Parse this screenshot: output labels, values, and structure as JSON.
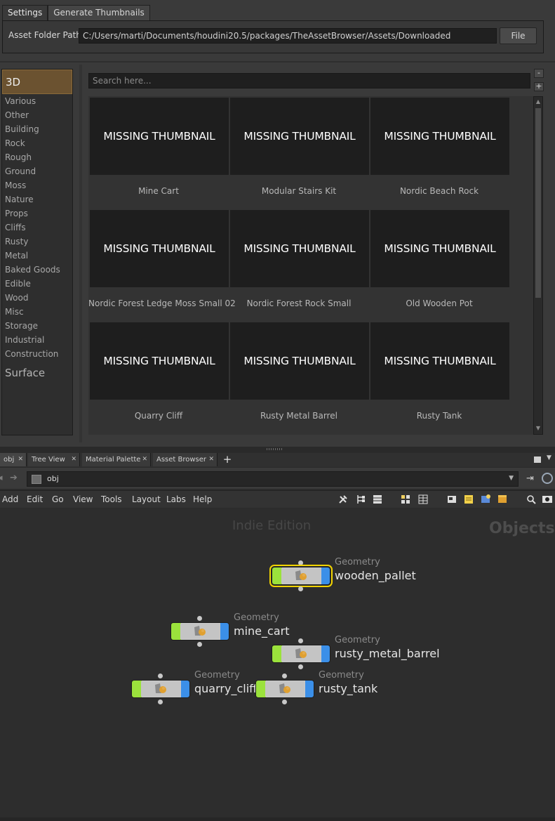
{
  "browser": {
    "tabs": [
      "Settings",
      "Generate Thumbnails"
    ],
    "asset_folder_label": "Asset Folder Path",
    "asset_folder_value": "C:/Users/marti/Documents/houdini20.5/packages/TheAssetBrowser/Assets/Downloaded",
    "file_button": "File",
    "search_placeholder": "Search here...",
    "minus_button": "-",
    "plus_button": "+",
    "categories": {
      "active_group": "3D",
      "items": [
        "Various",
        "Other",
        "Building",
        "Rock",
        "Rough",
        "Ground",
        "Moss",
        "Nature",
        "Props",
        "Cliffs",
        "Rusty",
        "Metal",
        "Baked Goods",
        "Edible",
        "Wood",
        "Misc",
        "Storage",
        "Industrial",
        "Construction"
      ],
      "other_group": "Surface"
    },
    "assets": [
      {
        "thumb": "MISSING THUMBNAIL",
        "name": "Mine Cart"
      },
      {
        "thumb": "MISSING THUMBNAIL",
        "name": "Modular Stairs Kit"
      },
      {
        "thumb": "MISSING THUMBNAIL",
        "name": "Nordic Beach Rock"
      },
      {
        "thumb": "MISSING THUMBNAIL",
        "name": "Nordic Forest Ledge Moss Small 02"
      },
      {
        "thumb": "MISSING THUMBNAIL",
        "name": "Nordic Forest Rock Small"
      },
      {
        "thumb": "MISSING THUMBNAIL",
        "name": "Old Wooden Pot"
      },
      {
        "thumb": "MISSING THUMBNAIL",
        "name": "Quarry Cliff"
      },
      {
        "thumb": "MISSING THUMBNAIL",
        "name": "Rusty Metal Barrel"
      },
      {
        "thumb": "MISSING THUMBNAIL",
        "name": "Rusty Tank"
      }
    ]
  },
  "network": {
    "tabs": [
      "obj",
      "Tree View",
      "Material Palette",
      "Asset Browser"
    ],
    "path": "obj",
    "menus": [
      "Add",
      "Edit",
      "Go",
      "View",
      "Tools",
      "Layout",
      "Labs",
      "Help"
    ],
    "edition_watermark": "Indie Edition",
    "context_watermark": "Objects",
    "nodes": [
      {
        "type": "Geometry",
        "name": "wooden_pallet",
        "selected": true
      },
      {
        "type": "Geometry",
        "name": "mine_cart",
        "selected": false
      },
      {
        "type": "Geometry",
        "name": "rusty_metal_barrel",
        "selected": false
      },
      {
        "type": "Geometry",
        "name": "quarry_cliff",
        "selected": false
      },
      {
        "type": "Geometry",
        "name": "rusty_tank",
        "selected": false
      }
    ]
  },
  "colors": {
    "active_category": "#6b5230",
    "node_left_flag": "#9be23c",
    "node_right_flag": "#3b8fe8",
    "selection_outline": "#f2d400"
  }
}
